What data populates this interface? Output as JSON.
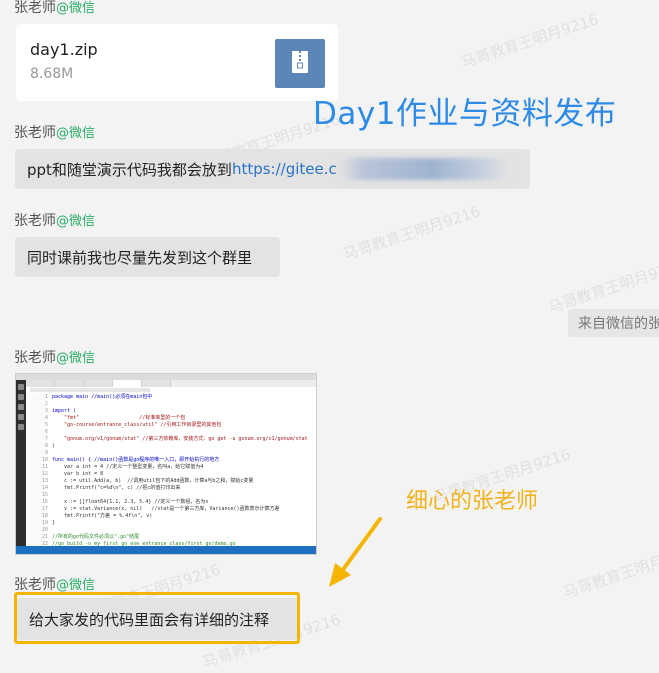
{
  "colors": {
    "background": "#f3f3f3",
    "bubble": "#e3e3e3",
    "wechat_green": "#2aae67",
    "link": "#2a73c9",
    "overlay_blue": "#2d8be6",
    "annotation_yellow": "#f4b400",
    "file_icon": "#5d86b8"
  },
  "messages": [
    {
      "sender": "张老师",
      "source": "@微信"
    },
    {
      "sender": "张老师",
      "source": "@微信",
      "text": "ppt和随堂演示代码我都会放到",
      "link": "https://gitee.c"
    },
    {
      "sender": "张老师",
      "source": "@微信",
      "text": "同时课前我也尽量先发到这个群里"
    },
    {
      "sender": "张老师",
      "source": "@微信"
    },
    {
      "sender": "张老师",
      "source": "@微信",
      "text": "给大家发的代码里面会有详细的注释"
    }
  ],
  "file": {
    "name": "day1.zip",
    "size": "8.68M",
    "icon": "zip-file-icon"
  },
  "system": {
    "wechat_source": "来自微信的张"
  },
  "overlay": {
    "title": "Day1作业与资料发布",
    "note": "细心的张老师"
  },
  "watermark": "马哥教育王明月9216",
  "code_lines": [
    {
      "n": "1",
      "code": "package main //main()必须在main包中"
    },
    {
      "n": "2",
      "code": ""
    },
    {
      "n": "3",
      "code": "import ("
    },
    {
      "n": "4",
      "code": "    \"fmt\"                    //标准库里的一个包"
    },
    {
      "n": "5",
      "code": "    \"go-course/entrance_class/util\" //引用工作目录里的其他包"
    },
    {
      "n": "6",
      "code": ""
    },
    {
      "n": "7",
      "code": "    \"gonum.org/v1/gonum/stat\" //第三方依赖库，安装方式：go get -u gonum.org/v1/gonum/stat"
    },
    {
      "n": "8",
      "code": ")"
    },
    {
      "n": "9",
      "code": ""
    },
    {
      "n": "10",
      "code": "func main() { //main()函数是go程序的唯一入口，即开始执行的地方"
    },
    {
      "n": "11",
      "code": "    var a int = 4 //定义一个整型变量，名叫a，给它赋值为4"
    },
    {
      "n": "12",
      "code": "    var b int = 8"
    },
    {
      "n": "13",
      "code": "    c := util.Add(a, b)  //调用util包下的Add函数，计算a与b之和，赋给c变量"
    },
    {
      "n": "14",
      "code": "    fmt.Printf(\"c=%d\\n\", c) //把c的值打印出来"
    },
    {
      "n": "15",
      "code": ""
    },
    {
      "n": "16",
      "code": "    x := []float64{1.1, 2.3, 5.4} //定义一个数组，名为x"
    },
    {
      "n": "17",
      "code": "    v := stat.Variance(x, nil)   //stat是一个第三方库，Variance()函数表示计算方差"
    },
    {
      "n": "18",
      "code": "    fmt.Printf(\"方差 = %.4f\\n\", v)"
    },
    {
      "n": "19",
      "code": "}"
    },
    {
      "n": "20",
      "code": ""
    },
    {
      "n": "21",
      "code": "//所有的go代码文件必须以\".go\"结尾"
    },
    {
      "n": "22",
      "code": "//go build -o my_first_go_exe entrance_class/first_go/demo.go"
    }
  ]
}
